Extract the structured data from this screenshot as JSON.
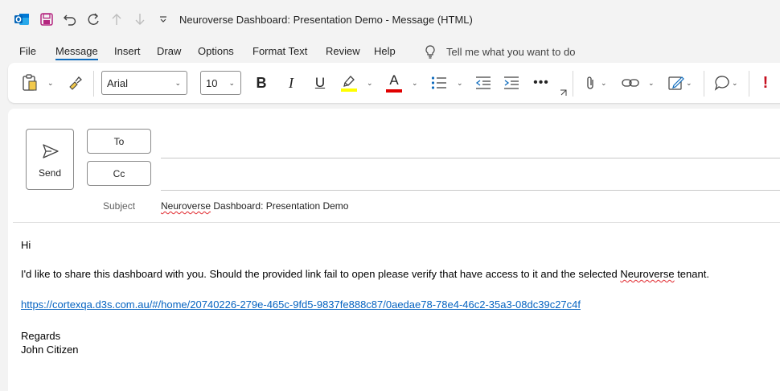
{
  "titlebar": {
    "title": "Neuroverse Dashboard: Presentation Demo  -  Message (HTML)",
    "icons": [
      "outlook-logo-icon",
      "save-icon",
      "undo-icon",
      "redo-icon",
      "up-arrow-icon",
      "down-arrow-icon",
      "customize-qat-icon"
    ]
  },
  "menu": {
    "tabs": [
      "File",
      "Message",
      "Insert",
      "Draw",
      "Options",
      "Format Text",
      "Review",
      "Help"
    ],
    "active": "Message",
    "tellme": "Tell me what you want to do"
  },
  "ribbon": {
    "font_name": "Arial",
    "font_size": "10",
    "bold": "B",
    "italic": "I",
    "underline": "U",
    "font_color_letter": "A",
    "highlight_color": "#ffff00",
    "font_color": "#e00000",
    "urgent_mark": "!"
  },
  "compose": {
    "send_label": "Send",
    "to_label": "To",
    "cc_label": "Cc",
    "subject_label": "Subject",
    "subject_word1": "Neuroverse",
    "subject_rest": " Dashboard: Presentation Demo"
  },
  "body": {
    "greeting": "Hi",
    "para_part1": "I'd like to share this dashboard with you. Should the provided link fail to open please verify that have access to it and the selected ",
    "para_word": "Neuroverse",
    "para_part2": " tenant.",
    "link": "https://cortexqa.d3s.com.au/#/home/20740226-279e-465c-9fd5-9837fe888c87/0aedae78-78e4-46c2-35a3-08dc39c27c4f",
    "regards": "Regards",
    "name": "John Citizen"
  },
  "colors": {
    "accent": "#0f6cbd",
    "link": "#0563c1",
    "urgent": "#c50f1f"
  }
}
